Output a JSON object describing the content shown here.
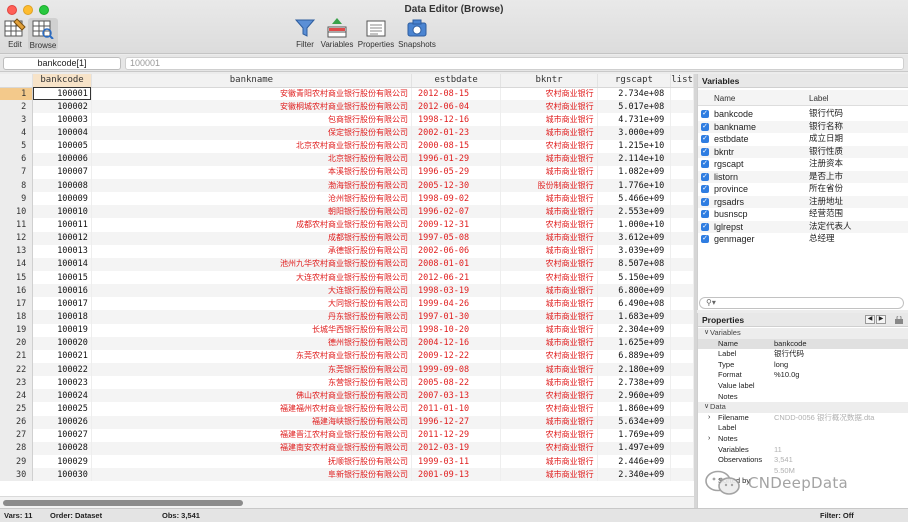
{
  "window": {
    "title": "Data Editor (Browse)"
  },
  "toolbar": {
    "edit": "Edit",
    "browse": "Browse",
    "filter": "Filter",
    "variables": "Variables",
    "properties": "Properties",
    "snapshots": "Snapshots"
  },
  "namebar": {
    "cell_ref": "bankcode[1]",
    "cell_value": "100001"
  },
  "grid": {
    "columns": [
      "bankcode",
      "bankname",
      "estbdate",
      "bkntr",
      "rgscapt",
      "list"
    ],
    "rows": [
      [
        "1",
        "100001",
        "安徽青阳农村商业银行股份有限公司",
        "2012-08-15",
        "农村商业银行",
        "2.734e+08"
      ],
      [
        "2",
        "100002",
        "安徽桐城农村商业银行股份有限公司",
        "2012-06-04",
        "农村商业银行",
        "5.017e+08"
      ],
      [
        "3",
        "100003",
        "包商银行股份有限公司",
        "1998-12-16",
        "城市商业银行",
        "4.731e+09"
      ],
      [
        "4",
        "100004",
        "保定银行股份有限公司",
        "2002-01-23",
        "城市商业银行",
        "3.000e+09"
      ],
      [
        "5",
        "100005",
        "北京农村商业银行股份有限公司",
        "2000-08-15",
        "农村商业银行",
        "1.215e+10"
      ],
      [
        "6",
        "100006",
        "北京银行股份有限公司",
        "1996-01-29",
        "城市商业银行",
        "2.114e+10"
      ],
      [
        "7",
        "100007",
        "本溪银行股份有限公司",
        "1996-05-29",
        "城市商业银行",
        "1.082e+09"
      ],
      [
        "8",
        "100008",
        "渤海银行股份有限公司",
        "2005-12-30",
        "股份制商业银行",
        "1.776e+10"
      ],
      [
        "9",
        "100009",
        "沧州银行股份有限公司",
        "1998-09-02",
        "城市商业银行",
        "5.466e+09"
      ],
      [
        "10",
        "100010",
        "朝阳银行股份有限公司",
        "1996-02-07",
        "城市商业银行",
        "2.553e+09"
      ],
      [
        "11",
        "100011",
        "成都农村商业银行股份有限公司",
        "2009-12-31",
        "农村商业银行",
        "1.000e+10"
      ],
      [
        "12",
        "100012",
        "成都银行股份有限公司",
        "1997-05-08",
        "城市商业银行",
        "3.612e+09"
      ],
      [
        "13",
        "100013",
        "承德银行股份有限公司",
        "2002-06-06",
        "城市商业银行",
        "3.039e+09"
      ],
      [
        "14",
        "100014",
        "池州九华农村商业银行股份有限公司",
        "2008-01-01",
        "农村商业银行",
        "8.507e+08"
      ],
      [
        "15",
        "100015",
        "大连农村商业银行股份有限公司",
        "2012-06-21",
        "农村商业银行",
        "5.150e+09"
      ],
      [
        "16",
        "100016",
        "大连银行股份有限公司",
        "1998-03-19",
        "城市商业银行",
        "6.800e+09"
      ],
      [
        "17",
        "100017",
        "大同银行股份有限公司",
        "1999-04-26",
        "城市商业银行",
        "6.490e+08"
      ],
      [
        "18",
        "100018",
        "丹东银行股份有限公司",
        "1997-01-30",
        "城市商业银行",
        "1.683e+09"
      ],
      [
        "19",
        "100019",
        "长城华西银行股份有限公司",
        "1998-10-20",
        "城市商业银行",
        "2.304e+09"
      ],
      [
        "20",
        "100020",
        "德州银行股份有限公司",
        "2004-12-16",
        "城市商业银行",
        "1.625e+09"
      ],
      [
        "21",
        "100021",
        "东莞农村商业银行股份有限公司",
        "2009-12-22",
        "农村商业银行",
        "6.889e+09"
      ],
      [
        "22",
        "100022",
        "东莞银行股份有限公司",
        "1999-09-08",
        "城市商业银行",
        "2.180e+09"
      ],
      [
        "23",
        "100023",
        "东营银行股份有限公司",
        "2005-08-22",
        "城市商业银行",
        "2.738e+09"
      ],
      [
        "24",
        "100024",
        "佛山农村商业银行股份有限公司",
        "2007-03-13",
        "农村商业银行",
        "2.960e+09"
      ],
      [
        "25",
        "100025",
        "福建福州农村商业银行股份有限公司",
        "2011-01-10",
        "农村商业银行",
        "1.860e+09"
      ],
      [
        "26",
        "100026",
        "福建海峡银行股份有限公司",
        "1996-12-27",
        "城市商业银行",
        "5.634e+09"
      ],
      [
        "27",
        "100027",
        "福建晋江农村商业银行股份有限公司",
        "2011-12-29",
        "农村商业银行",
        "1.769e+09"
      ],
      [
        "28",
        "100028",
        "福建南安农村商业银行股份有限公司",
        "2012-03-19",
        "农村商业银行",
        "1.497e+09"
      ],
      [
        "29",
        "100029",
        "抚顺银行股份有限公司",
        "1999-03-11",
        "城市商业银行",
        "2.446e+09"
      ],
      [
        "30",
        "100030",
        "阜新银行股份有限公司",
        "2001-09-13",
        "城市商业银行",
        "2.340e+09"
      ]
    ]
  },
  "variables_panel": {
    "title": "Variables",
    "col_name": "Name",
    "col_label": "Label",
    "items": [
      {
        "name": "bankcode",
        "label": "银行代码"
      },
      {
        "name": "bankname",
        "label": "银行名称"
      },
      {
        "name": "estbdate",
        "label": "成立日期"
      },
      {
        "name": "bkntr",
        "label": "银行性质"
      },
      {
        "name": "rgscapt",
        "label": "注册资本"
      },
      {
        "name": "listorn",
        "label": "是否上市"
      },
      {
        "name": "province",
        "label": "所在省份"
      },
      {
        "name": "rgsadrs",
        "label": "注册地址"
      },
      {
        "name": "busnscp",
        "label": "经营范围"
      },
      {
        "name": "lglrepst",
        "label": "法定代表人"
      },
      {
        "name": "genmager",
        "label": "总经理"
      }
    ],
    "search_icon": "search-icon"
  },
  "properties_panel": {
    "title": "Properties",
    "group_variables": "Variables",
    "name_key": "Name",
    "name_val": "bankcode",
    "label_key": "Label",
    "label_val": "银行代码",
    "type_key": "Type",
    "type_val": "long",
    "format_key": "Format",
    "format_val": "%10.0g",
    "value_label_key": "Value label",
    "notes_key": "Notes",
    "group_data": "Data",
    "filename_key": "Filename",
    "filename_val": "CNDD-0056 银行概况数据.dta",
    "data_label_key": "Label",
    "data_notes_key": "Notes",
    "variables_key": "Variables",
    "variables_val": "11",
    "observations_key": "Observations",
    "observations_val": "3,541",
    "size_val": "5.50M",
    "sorted_key": "Sorted by"
  },
  "watermark": {
    "text": "CNDeepData"
  },
  "status": {
    "vars": "Vars: 11",
    "order": "Order: Dataset",
    "obs": "Obs: 3,541",
    "filter": "Filter: Off"
  }
}
